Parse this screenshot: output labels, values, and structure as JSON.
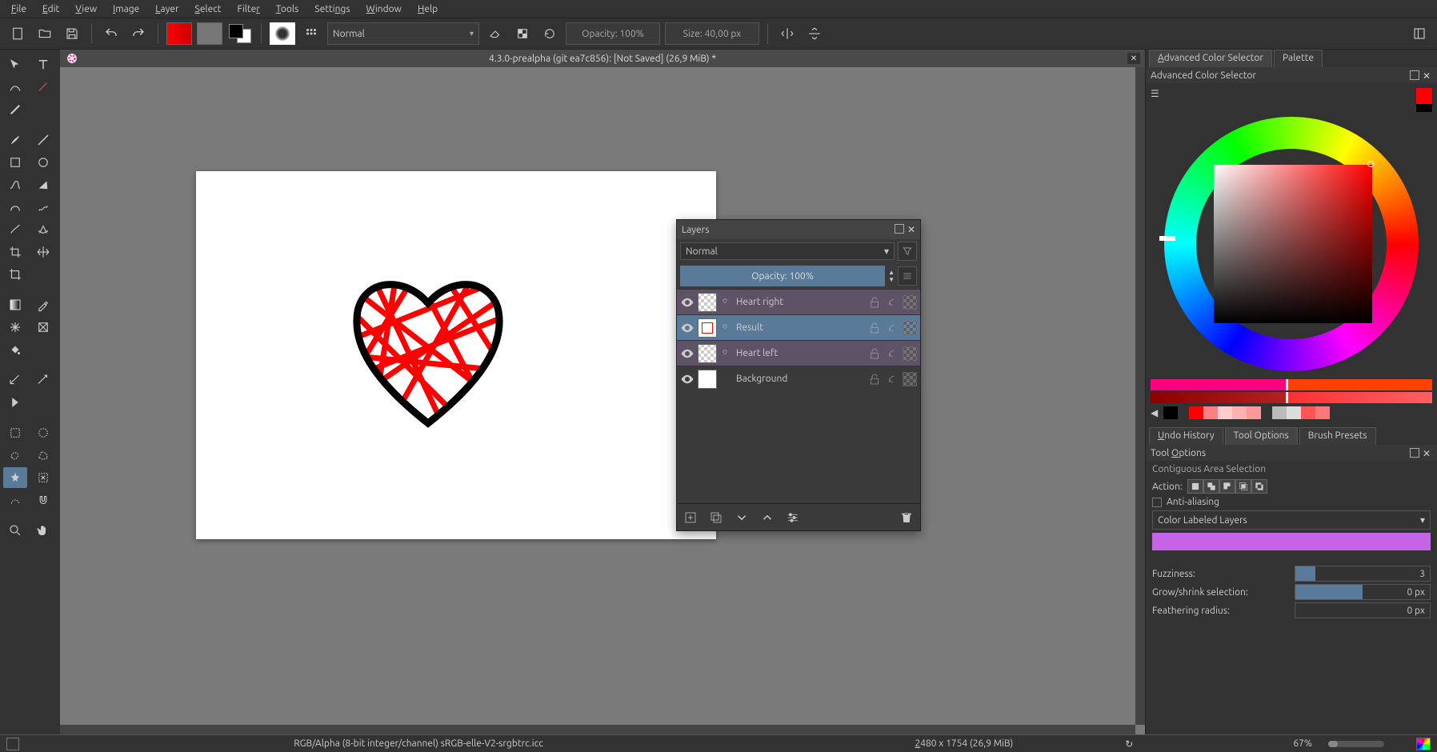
{
  "menu": {
    "file": "File",
    "edit": "Edit",
    "view": "View",
    "image": "Image",
    "layer": "Layer",
    "select": "Select",
    "filter": "Filter",
    "tools": "Tools",
    "settings": "Settings",
    "window": "Window",
    "help": "Help"
  },
  "toolbar": {
    "blend_mode": "Normal",
    "opacity_label": "Opacity: 100%",
    "size_label": "Size: 40,00 px"
  },
  "document": {
    "title": "4.3.0-prealpha (git ea7c856):  [Not Saved]  (26,9 MiB) *"
  },
  "layers_panel": {
    "title": "Layers",
    "blend": "Normal",
    "opacity": "Opacity:  100%",
    "layers": [
      {
        "name": "Heart right"
      },
      {
        "name": "Result"
      },
      {
        "name": "Heart left"
      },
      {
        "name": "Background"
      }
    ]
  },
  "right": {
    "tab_acs": "Advanced Color Selector",
    "tab_palette": "Palette",
    "acs_title": "Advanced Color Selector",
    "tab_undo": "Undo History",
    "tab_toolopt": "Tool Options",
    "tab_brushes": "Brush Presets",
    "tool_title": "Tool Options",
    "tool_sub": "Contiguous Area Selection",
    "action": "Action:",
    "anti": "Anti-aliasing",
    "labeled": "Color Labeled Layers",
    "fuzziness": "Fuzziness:",
    "fuzziness_val": "3",
    "grow": "Grow/shrink selection:",
    "grow_val": "0 px",
    "feather": "Feathering radius:",
    "feather_val": "0 px"
  },
  "status": {
    "profile": "RGB/Alpha (8-bit integer/channel)  sRGB-elle-V2-srgbtrc.icc",
    "dims": "2480 x 1754 (26,9 MiB)",
    "zoom": "67%"
  }
}
